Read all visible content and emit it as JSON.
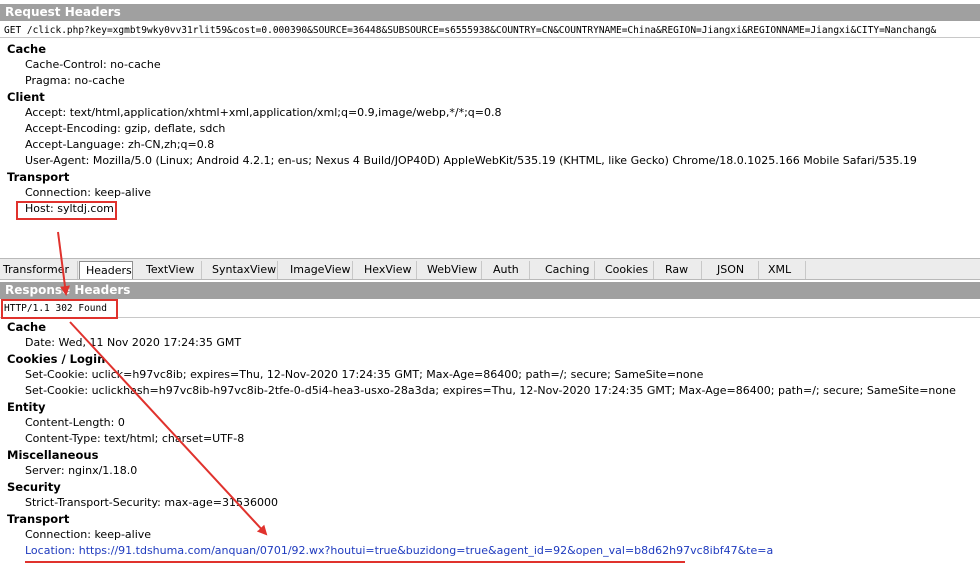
{
  "request": {
    "section_title": "Request Headers",
    "request_line": "GET /click.php?key=xgmbt9wky0vv31rlit59&cost=0.000390&SOURCE=36448&SUBSOURCE=s6555938&COUNTRY=CN&COUNTRYNAME=China&REGION=Jiangxi&REGIONNAME=Jiangxi&CITY=Nanchang&",
    "groups": [
      {
        "name": "Cache",
        "headers": [
          "Cache-Control: no-cache",
          "Pragma: no-cache"
        ]
      },
      {
        "name": "Client",
        "headers": [
          "Accept: text/html,application/xhtml+xml,application/xml;q=0.9,image/webp,*/*;q=0.8",
          "Accept-Encoding: gzip, deflate, sdch",
          "Accept-Language: zh-CN,zh;q=0.8",
          "User-Agent: Mozilla/5.0 (Linux; Android 4.2.1; en-us; Nexus 4 Build/JOP40D) AppleWebKit/535.19 (KHTML, like Gecko) Chrome/18.0.1025.166 Mobile Safari/535.19"
        ]
      },
      {
        "name": "Transport",
        "headers": [
          "Connection: keep-alive",
          "Host: syltdj.com"
        ]
      }
    ]
  },
  "tabs": [
    {
      "label": "Transformer",
      "active": false
    },
    {
      "label": "Headers",
      "active": true
    },
    {
      "label": "TextView",
      "active": false
    },
    {
      "label": "SyntaxView",
      "active": false
    },
    {
      "label": "ImageView",
      "active": false
    },
    {
      "label": "HexView",
      "active": false
    },
    {
      "label": "WebView",
      "active": false
    },
    {
      "label": "Auth",
      "active": false
    },
    {
      "label": "Caching",
      "active": false
    },
    {
      "label": "Cookies",
      "active": false
    },
    {
      "label": "Raw",
      "active": false
    },
    {
      "label": "JSON",
      "active": false
    },
    {
      "label": "XML",
      "active": false
    }
  ],
  "response": {
    "section_title": "Response Headers",
    "status_line": "HTTP/1.1 302 Found",
    "groups": [
      {
        "name": "Cache",
        "headers": [
          "Date: Wed, 11 Nov 2020 17:24:35 GMT"
        ]
      },
      {
        "name": "Cookies / Login",
        "headers": [
          "Set-Cookie: uclick=h97vc8ib; expires=Thu, 12-Nov-2020 17:24:35 GMT; Max-Age=86400; path=/; secure; SameSite=none",
          "Set-Cookie: uclickhash=h97vc8ib-h97vc8ib-2tfe-0-d5i4-hea3-usxo-28a3da; expires=Thu, 12-Nov-2020 17:24:35 GMT; Max-Age=86400; path=/; secure; SameSite=none"
        ]
      },
      {
        "name": "Entity",
        "headers": [
          "Content-Length: 0",
          "Content-Type: text/html; charset=UTF-8"
        ]
      },
      {
        "name": "Miscellaneous",
        "headers": [
          "Server: nginx/1.18.0"
        ]
      },
      {
        "name": "Security",
        "headers": [
          "Strict-Transport-Security: max-age=31536000"
        ]
      },
      {
        "name": "Transport",
        "headers": [
          "Connection: keep-alive",
          "Location: https://91.tdshuma.com/anquan/0701/92.wx?houtui=true&buzidong=true&agent_id=92&open_val=b8d62h97vc8ibf47&te=a"
        ]
      }
    ]
  },
  "colors": {
    "header_bg": "#a0a0a0",
    "annotation_red": "#e0322d",
    "link_blue": "#1f3bbf"
  }
}
